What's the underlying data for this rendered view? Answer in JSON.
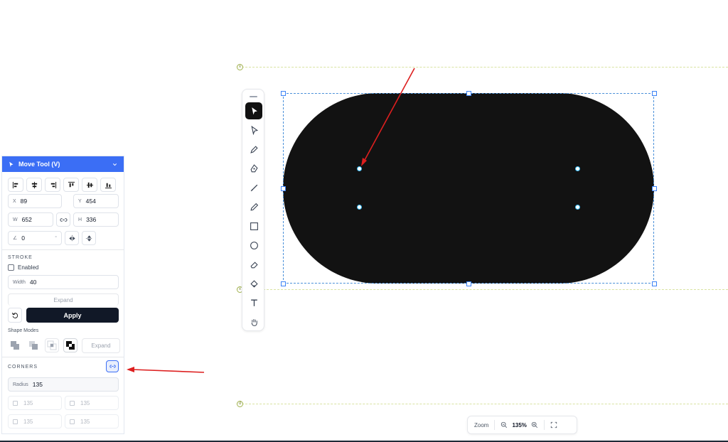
{
  "panel": {
    "title": "Move Tool (V)",
    "position": {
      "x_label": "X",
      "x_value": "89",
      "y_label": "Y",
      "y_value": "454"
    },
    "size": {
      "w_label": "W",
      "w_value": "652",
      "h_label": "H",
      "h_value": "336"
    },
    "rotation": {
      "label": "∠",
      "value": "0",
      "unit": "°"
    },
    "stroke": {
      "heading": "STROKE",
      "enabled_label": "Enabled",
      "width_label": "Width",
      "width_value": "40",
      "expand_label": "Expand",
      "apply_label": "Apply"
    },
    "shape_modes": {
      "heading": "Shape Modes",
      "expand_label": "Expand"
    },
    "corners": {
      "heading": "CORNERS",
      "radius_label": "Radius",
      "radius_value": "135",
      "individual": [
        "135",
        "135",
        "135",
        "135"
      ]
    }
  },
  "zoom": {
    "label": "Zoom",
    "value": "135%"
  },
  "colors": {
    "accent": "#3b6ef5",
    "shape_fill": "#121212",
    "selection": "#3b82f6",
    "annotation": "#dd1f1f"
  },
  "tools": [
    "move-tool",
    "direct-select-tool",
    "pen-tool",
    "anchor-pen-tool",
    "brush-tool",
    "pencil-tool",
    "rectangle-tool",
    "ellipse-tool",
    "eraser-tool",
    "fill-tool",
    "text-tool",
    "hand-tool"
  ]
}
